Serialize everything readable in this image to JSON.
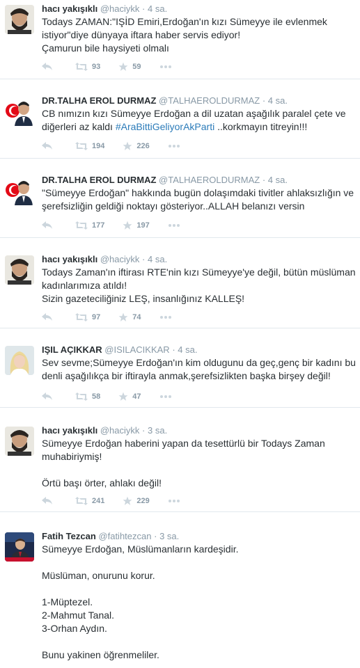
{
  "tweets": [
    {
      "name": "hacı yakışıklı",
      "handle": "@haciykk",
      "sep": "·",
      "time": "4 sa.",
      "text": "Todays ZAMAN:\"IŞİD Emiri,Erdoğan'ın kızı Sümeyye ile evlenmek istiyor\"diye dünyaya iftara haber servis ediyor!\nÇamurun bile haysiyeti olmalı",
      "retweets": "93",
      "favorites": "59",
      "avatar": "haci"
    },
    {
      "name": "DR.TALHA EROL DURMAZ",
      "handle": "@TALHAEROLDURMAZ",
      "sep": "·",
      "time": "4 sa.",
      "text_before": "CB nımızın kızı Sümeyye Erdoğan a dil uzatan aşağılık paralel çete ve diğerleri az kaldı ",
      "hashtag": "#AraBittiGeliyorAkParti",
      "text_after": " ..korkmayın titreyin!!!",
      "retweets": "194",
      "favorites": "226",
      "avatar": "talha"
    },
    {
      "name": "DR.TALHA EROL DURMAZ",
      "handle": "@TALHAEROLDURMAZ",
      "sep": "·",
      "time": "4 sa.",
      "text": "\"Sümeyye Erdoğan\" hakkında bugün dolaşımdaki tivitler ahlaksızlığın ve şerefsizliğin geldiği noktayı gösteriyor..ALLAH belanızı versin",
      "retweets": "177",
      "favorites": "197",
      "avatar": "talha"
    },
    {
      "name": "hacı yakışıklı",
      "handle": "@haciykk",
      "sep": "·",
      "time": "4 sa.",
      "text": "Todays Zaman'ın iftirası RTE'nin kızı Sümeyye'ye değil, bütün müslüman kadınlarımıza atıldı!\nSizin gazeteciliğiniz LEŞ, insanlığınız KALLEŞ!",
      "retweets": "97",
      "favorites": "74",
      "avatar": "haci"
    },
    {
      "name": "IŞIL AÇIKKAR",
      "handle": "@ISILACIKKAR",
      "sep": "·",
      "time": "4 sa.",
      "text": "Sev sevme;Sümeyye Erdoğan'ın kim oldugunu da geç,genç bir kadını bu denli aşağılıkça bir iftirayla anmak,şerefsizlikten başka birşey değil!",
      "retweets": "58",
      "favorites": "47",
      "avatar": "isil"
    },
    {
      "name": "hacı yakışıklı",
      "handle": "@haciykk",
      "sep": "·",
      "time": "3 sa.",
      "text": "Sümeyye Erdoğan haberini yapan da tesettürlü bir Todays Zaman muhabiriymiş!\n\nÖrtü başı örter, ahlakı değil!",
      "retweets": "241",
      "favorites": "229",
      "avatar": "haci"
    },
    {
      "name": "Fatih Tezcan",
      "handle": "@fatihtezcan",
      "sep": "·",
      "time": "3 sa.",
      "text": "Sümeyye Erdoğan, Müslümanların kardeşidir.\n\nMüslüman, onurunu korur.\n\n1-Müptezel.\n2-Mahmut Tanal.\n3-Orhan Aydın.\n\nBunu yakinen öğrenmeliler.",
      "avatar": "fatih"
    }
  ],
  "icons": {
    "reply": "reply-icon",
    "retweet": "retweet-icon",
    "favorite": "star-icon",
    "more": "more-icon"
  },
  "colors": {
    "link": "#2b7bb9",
    "muted": "#8899a6",
    "text": "#292f33",
    "divider": "#e1e8ed"
  }
}
